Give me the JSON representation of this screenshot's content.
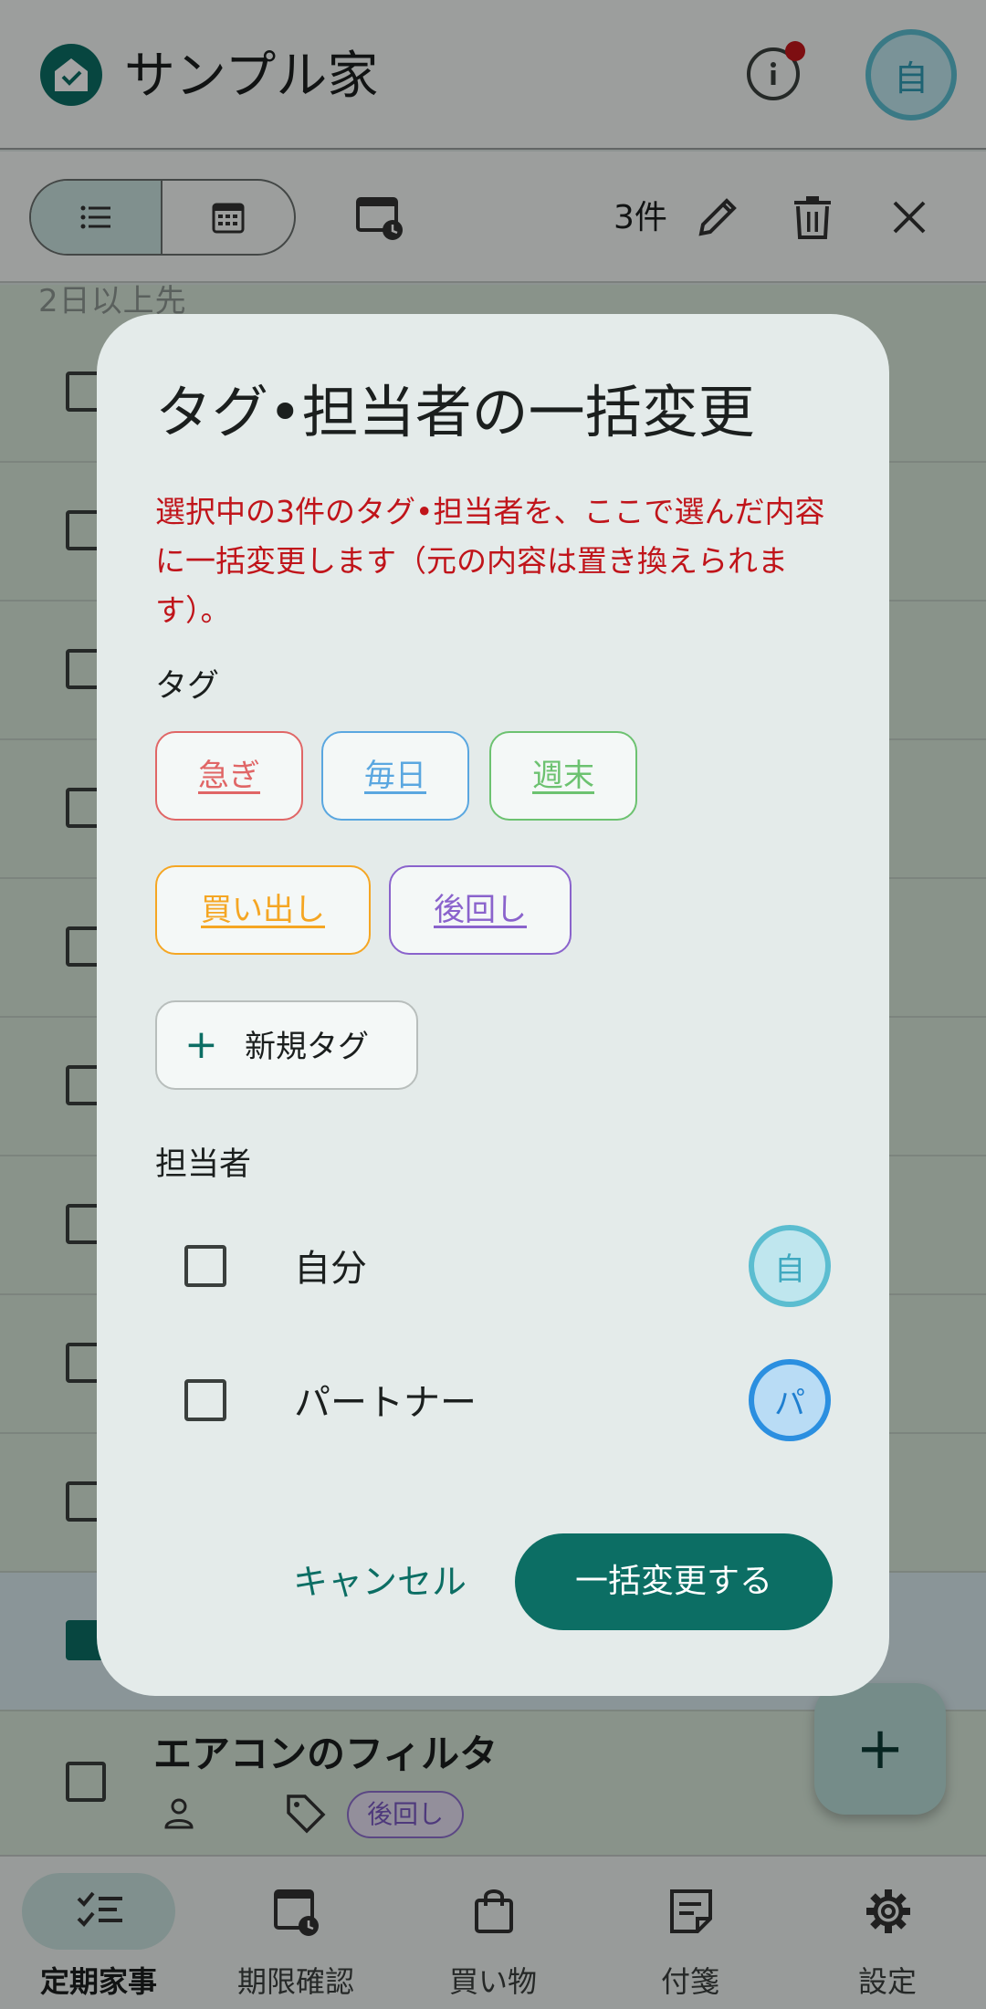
{
  "header": {
    "title": "サンプル家",
    "avatar": "自"
  },
  "toolbar": {
    "selected_count": "3件"
  },
  "list": {
    "section_label": "2日以上先",
    "item_title": "エアコンのフィルタ",
    "item_tag": "後回し"
  },
  "fab": {
    "label": "+"
  },
  "bottom_nav": {
    "items": [
      {
        "label": "定期家事",
        "icon": "checklist-icon"
      },
      {
        "label": "期限確認",
        "icon": "calendar-clock-icon"
      },
      {
        "label": "買い物",
        "icon": "shopping-bag-icon"
      },
      {
        "label": "付箋",
        "icon": "sticky-note-icon"
      },
      {
        "label": "設定",
        "icon": "gear-icon"
      }
    ]
  },
  "dialog": {
    "title": "タグ•担当者の一括変更",
    "warning": "選択中の3件のタグ•担当者を、ここで選んだ内容に一括変更します（元の内容は置き換えられます）。",
    "tags_label": "タグ",
    "tags": [
      {
        "label": "急ぎ",
        "color": "#e06666"
      },
      {
        "label": "毎日",
        "color": "#5aa7e0"
      },
      {
        "label": "週末",
        "color": "#6cc270"
      },
      {
        "label": "買い出し",
        "color": "#f5a623"
      },
      {
        "label": "後回し",
        "color": "#8a63cc"
      }
    ],
    "new_tag_label": "新規タグ",
    "assignees_label": "担当者",
    "assignees": [
      {
        "name": "自分",
        "avatar": "自",
        "checked": false
      },
      {
        "name": "パートナー",
        "avatar": "パ",
        "checked": false
      }
    ],
    "cancel_label": "キャンセル",
    "apply_label": "一括変更する"
  },
  "colors": {
    "primary": "#0c6e64",
    "warning": "#c0141a",
    "avatar_self_border": "#5bbdd0",
    "avatar_partner_border": "#2b8fe0"
  }
}
